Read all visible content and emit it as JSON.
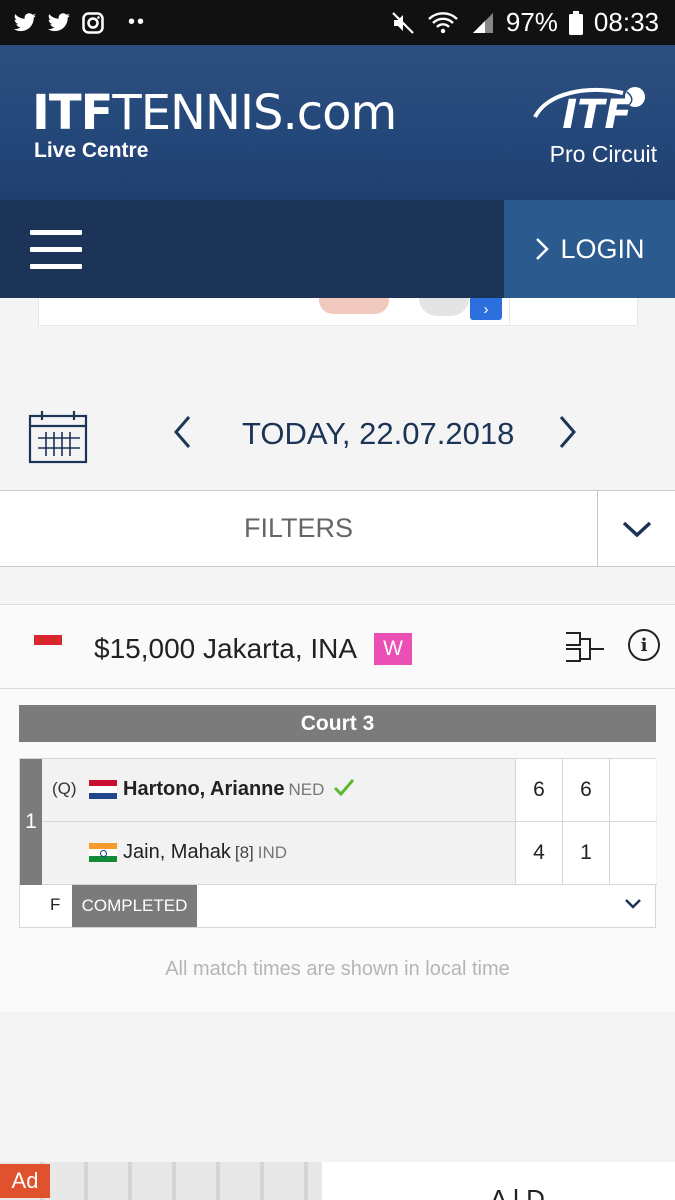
{
  "status_bar": {
    "battery": "97%",
    "time": "08:33",
    "left_icons": [
      "twitter-icon",
      "twitter-icon",
      "instagram-icon"
    ],
    "dots": "••"
  },
  "header": {
    "logo_itf": "ITF",
    "logo_tennis": "TENNIS.com",
    "logo_sub": "Live Centre",
    "pro_logo": "ITF",
    "pro_sub": "Pro Circuit"
  },
  "nav": {
    "login_label": "LOGIN"
  },
  "date_bar": {
    "label": "TODAY, 22.07.2018",
    "prev": "‹",
    "next": "›"
  },
  "filters": {
    "label": "FILTERS"
  },
  "tournament": {
    "name": "$15,000 Jakarta, INA",
    "badge": "W",
    "court": "Court 3",
    "match": {
      "number": "1",
      "player1": {
        "qualifier": "(Q)",
        "name": "Hartono, Arianne",
        "country": "NED",
        "scores": [
          "6",
          "6",
          ""
        ]
      },
      "player2": {
        "name": "Jain, Mahak",
        "seed": "[8]",
        "country": "IND",
        "scores": [
          "4",
          "1",
          ""
        ]
      },
      "round": "F",
      "status": "COMPLETED"
    },
    "note": "All match times are shown in local time"
  },
  "bottom_ad": {
    "tag": "Ad",
    "text": "A  l  D"
  },
  "colors": {
    "header": "#24477a",
    "nav_dark": "#1c3457",
    "login": "#2b5a8f",
    "badge_w": "#ea4fb4",
    "court_bar": "#7b7b7b",
    "check": "#5cb82e"
  }
}
